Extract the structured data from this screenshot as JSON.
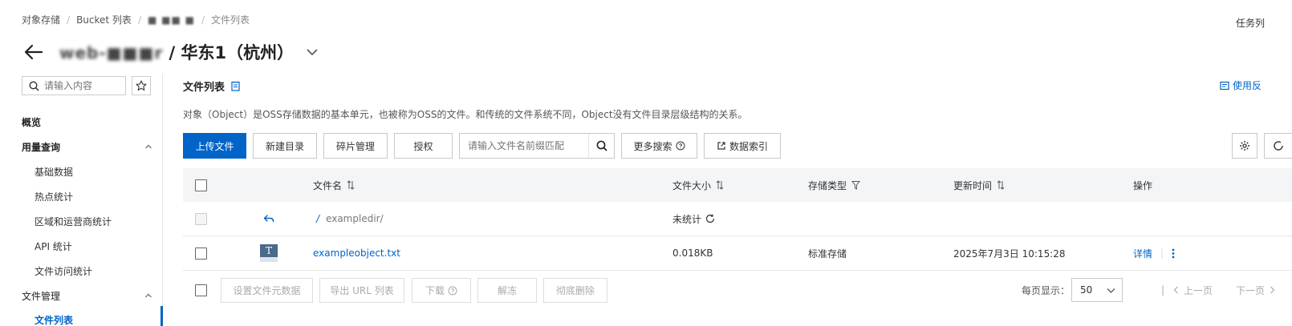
{
  "breadcrumb": {
    "items": [
      "对象存储",
      "Bucket 列表",
      "■ ■■ ■",
      "文件列表"
    ]
  },
  "task_link": "任务列",
  "title": {
    "bucket_name_blurred": "web-■■■r",
    "region": " / 华东1（杭州）"
  },
  "sidebar": {
    "search_placeholder": "请输入内容",
    "overview": "概览",
    "usage_group": "用量查询",
    "usage_items": [
      "基础数据",
      "热点统计",
      "区域和运营商统计",
      "API 统计",
      "文件访问统计"
    ],
    "file_mgmt_group": "文件管理",
    "file_mgmt_current": "文件列表"
  },
  "main": {
    "section_title": "文件列表",
    "feedback": "使用反",
    "description": "对象（Object）是OSS存储数据的基本单元，也被称为OSS的文件。和传统的文件系统不同，Object没有文件目录层级结构的关系。",
    "toolbar": {
      "upload": "上传文件",
      "new_dir": "新建目录",
      "fragments": "碎片管理",
      "authorize": "授权",
      "search_placeholder": "请输入文件名前缀匹配",
      "more_search": "更多搜索",
      "data_index": "数据索引"
    },
    "table": {
      "headers": {
        "name": "文件名",
        "size": "文件大小",
        "storage": "存储类型",
        "updated": "更新时间",
        "actions": "操作"
      },
      "parent_row": {
        "path_prefix": "/",
        "path": "exampledir/",
        "size": "未统计"
      },
      "rows": [
        {
          "icon_letter": "T",
          "name": "exampleobject.txt",
          "size": "0.018KB",
          "storage": "标准存储",
          "updated": "2025年7月3日 10:15:28",
          "action": "详情"
        }
      ]
    },
    "footer": {
      "set_metadata": "设置文件元数据",
      "export_url": "导出 URL 列表",
      "download": "下载",
      "unfreeze": "解冻",
      "delete": "彻底删除",
      "page_size_label": "每页显示：",
      "page_size": "50",
      "prev": "上一页",
      "next": "下一页"
    }
  },
  "colors": {
    "primary": "#0064c8",
    "header_bg": "#f4f5f7"
  }
}
